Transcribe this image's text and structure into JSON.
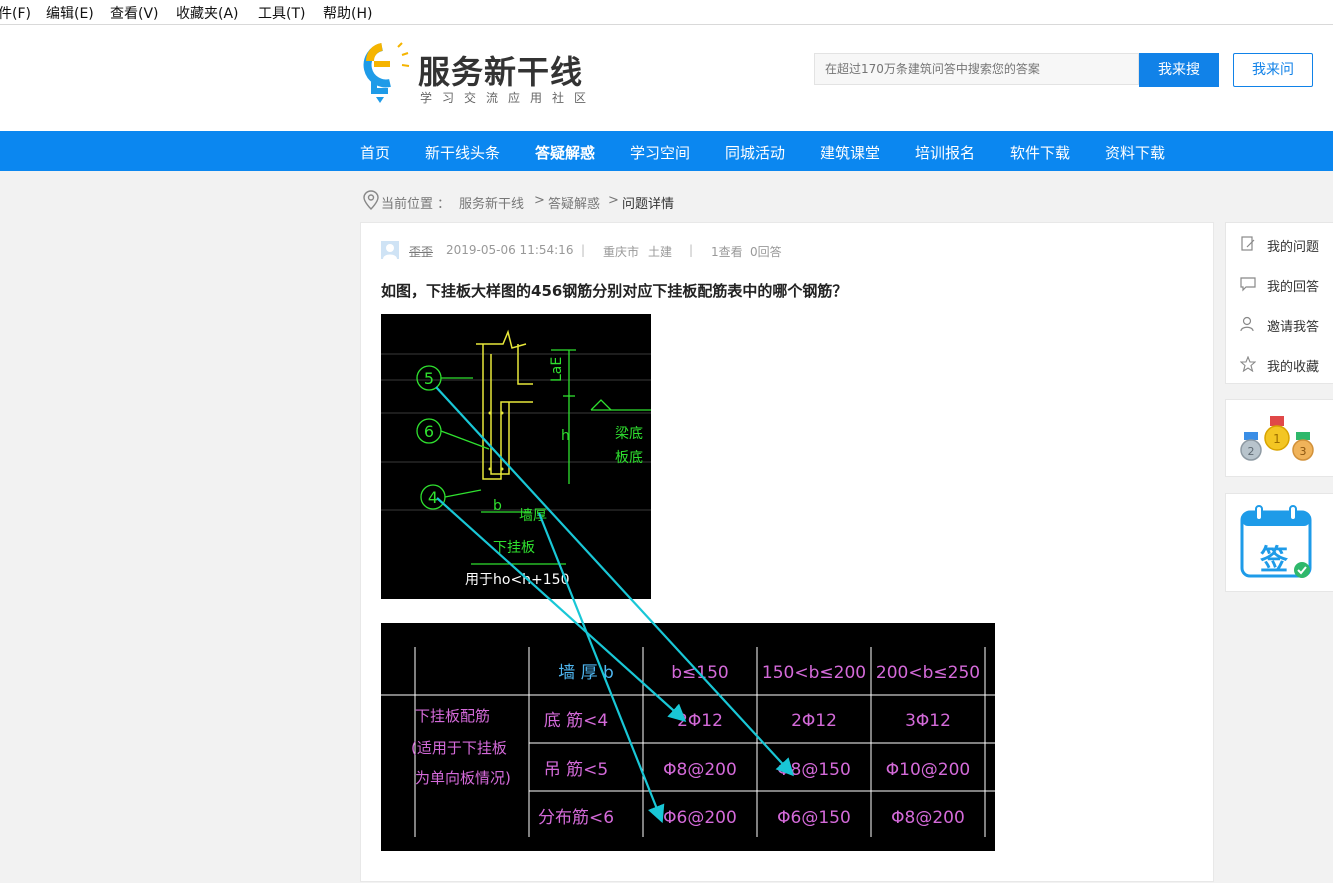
{
  "menubar": [
    "件(F)",
    "编辑(E)",
    "查看(V)",
    "收藏夹(A)",
    "工具(T)",
    "帮助(H)"
  ],
  "logo": {
    "title": "服务新干线",
    "subtitle": "学习交流应用社区"
  },
  "search": {
    "placeholder": "在超过170万条建筑问答中搜索您的答案",
    "button": "我来搜",
    "ask": "我来问"
  },
  "nav": [
    "首页",
    "新干线头条",
    "答疑解惑",
    "学习空间",
    "同城活动",
    "建筑课堂",
    "培训报名",
    "软件下载",
    "资料下载"
  ],
  "breadcrumb": {
    "label": "当前位置 ：",
    "items": [
      "服务新干线",
      "答疑解惑",
      "问题详情"
    ],
    "sep": ">"
  },
  "question": {
    "user": "歪歪",
    "time": "2019-05-06 11:54:16",
    "city": "重庆市",
    "category": "土建",
    "views": "1查看",
    "answers": "0回答",
    "title": "如图，下挂板大样图的456钢筋分别对应下挂板配筋表中的哪个钢筋？"
  },
  "sidebar": {
    "items": [
      "我的问题",
      "我的回答",
      "邀请我答",
      "我的收藏"
    ],
    "sign": "签"
  },
  "drawing1": {
    "markers": [
      "5",
      "6",
      "4"
    ],
    "labels": [
      "LaE",
      "h",
      "梁底",
      "板底",
      "b",
      "墙厚",
      "下挂板",
      "用于ho<h+150"
    ]
  },
  "drawing2": {
    "rowhead": [
      "下挂板配筋",
      "(适用于下挂板",
      "为单向板情况)"
    ],
    "header": [
      "墙 厚 b",
      "b≤150",
      "150<b≤200",
      "200<b≤250"
    ],
    "rows": [
      [
        "底 筋<4",
        "2Φ12",
        "2Φ12",
        "3Φ12"
      ],
      [
        "吊 筋<5",
        "Φ8@200",
        "Φ8@150",
        "Φ10@200"
      ],
      [
        "分布筋<6",
        "Φ6@200",
        "Φ6@150",
        "Φ8@200"
      ]
    ]
  },
  "colors": {
    "accent": "#0b87f0",
    "button": "#1182e8",
    "cad_green": "#2fe02f",
    "cad_yellow": "#e8e83a",
    "cad_magenta": "#d46ad9",
    "arrow": "#19c7d6"
  }
}
